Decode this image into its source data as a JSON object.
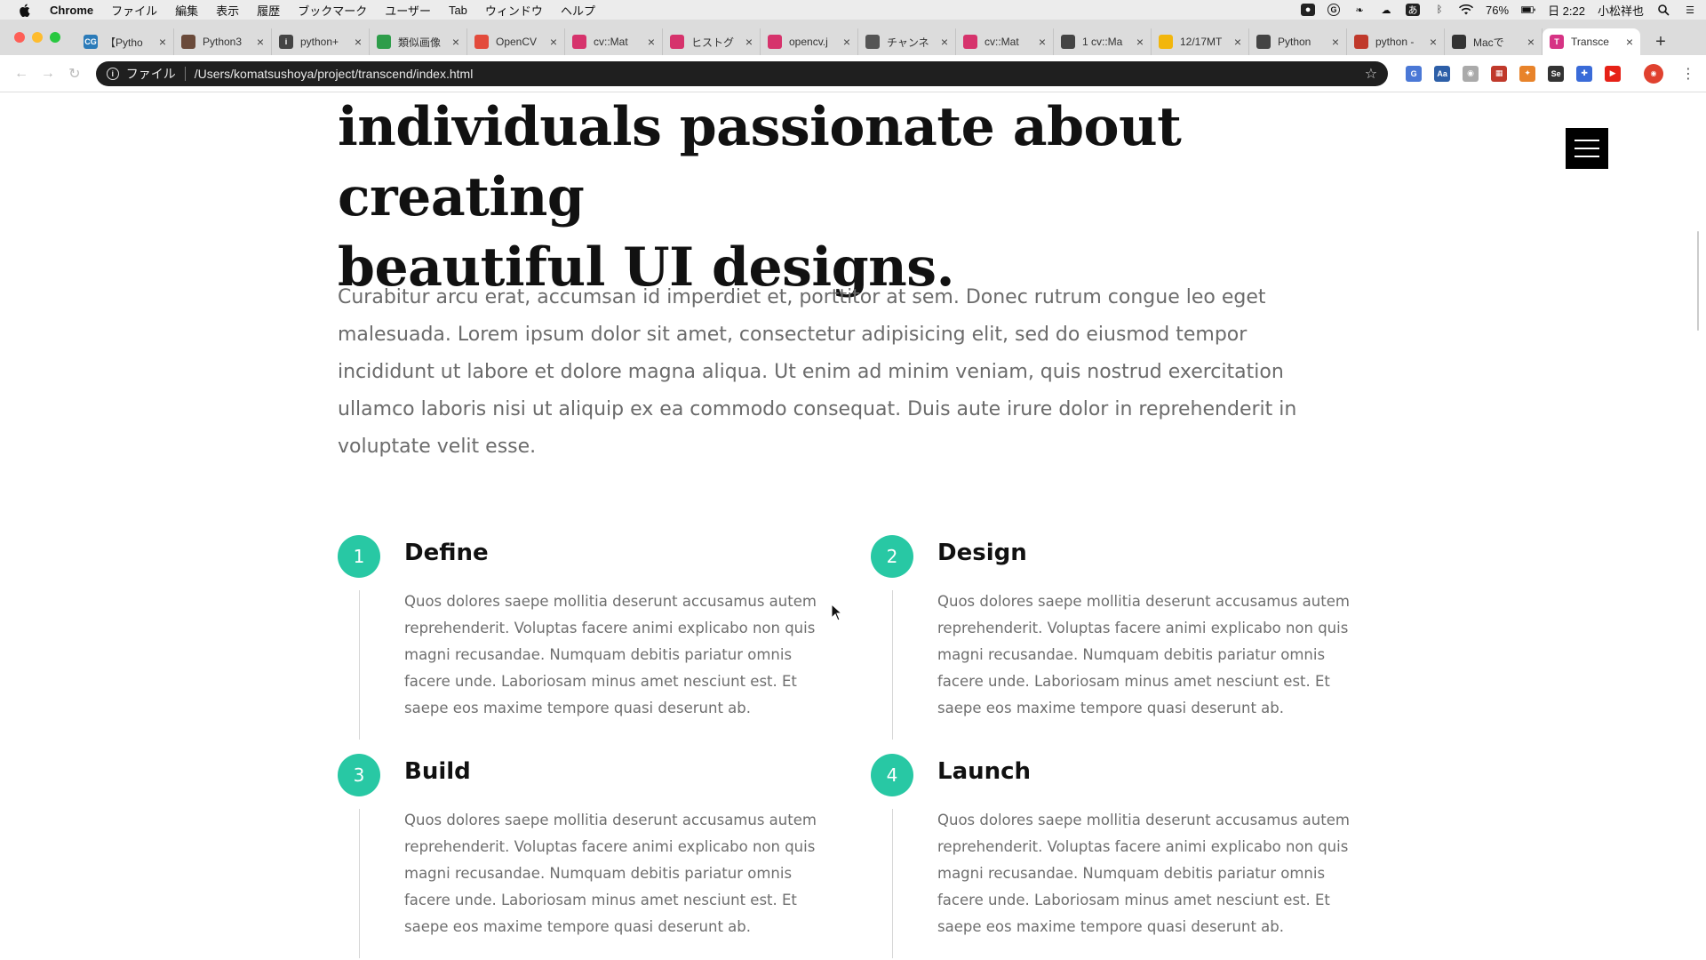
{
  "menubar": {
    "app_name": "Chrome",
    "items": [
      "ファイル",
      "編集",
      "表示",
      "履歴",
      "ブックマーク",
      "ユーザー",
      "Tab",
      "ウィンドウ",
      "ヘルプ"
    ],
    "battery": "76%",
    "clock": "日 2:22",
    "user": "小松祥也"
  },
  "tabs": [
    {
      "title": "【Pytho",
      "color": "#2b7bb9",
      "glyph": "CG"
    },
    {
      "title": "Python3",
      "color": "#6a4a3a",
      "glyph": ""
    },
    {
      "title": "python+",
      "color": "#444",
      "glyph": "i"
    },
    {
      "title": "類似画像",
      "color": "#2e9d4a",
      "glyph": ""
    },
    {
      "title": "OpenCV",
      "color": "#e34b3c",
      "glyph": ""
    },
    {
      "title": "cv::Mat",
      "color": "#d6336c",
      "glyph": ""
    },
    {
      "title": "ヒストグ",
      "color": "#d6336c",
      "glyph": ""
    },
    {
      "title": "opencv.j",
      "color": "#d6336c",
      "glyph": ""
    },
    {
      "title": "チャンネ",
      "color": "#555",
      "glyph": ""
    },
    {
      "title": "cv::Mat",
      "color": "#d6336c",
      "glyph": ""
    },
    {
      "title": "1 cv::Ma",
      "color": "#444",
      "glyph": ""
    },
    {
      "title": "12/17MT",
      "color": "#f2b60c",
      "glyph": ""
    },
    {
      "title": "Python",
      "color": "#444",
      "glyph": ""
    },
    {
      "title": "python -",
      "color": "#c0392b",
      "glyph": ""
    },
    {
      "title": "Macで",
      "color": "#333",
      "glyph": ""
    },
    {
      "title": "Transce",
      "color": "#d63384",
      "glyph": "T"
    }
  ],
  "toolbar": {
    "scheme": "ファイル",
    "url": "/Users/komatsushoya/project/transcend/index.html"
  },
  "page": {
    "headline_line1": "individuals passionate about creating",
    "headline_line2": "beautiful UI designs.",
    "lead": "Curabitur arcu erat, accumsan id imperdiet et, porttitor at sem. Donec rutrum congue leo eget malesuada. Lorem ipsum dolor sit amet, consectetur adipisicing elit, sed do eiusmod tempor incididunt ut labore et dolore magna aliqua. Ut enim ad minim veniam, quis nostrud exercitation ullamco laboris nisi ut aliquip ex ea commodo consequat. Duis aute irure dolor in reprehenderit in voluptate velit esse.",
    "accent_color": "#28c8a4",
    "steps": [
      {
        "num": "1",
        "title": "Define",
        "body": "Quos dolores saepe mollitia deserunt accusamus autem reprehenderit. Voluptas facere animi explicabo non quis magni recusandae. Numquam debitis pariatur omnis facere unde. Laboriosam minus amet nesciunt est. Et saepe eos maxime tempore quasi deserunt ab."
      },
      {
        "num": "2",
        "title": "Design",
        "body": "Quos dolores saepe mollitia deserunt accusamus autem reprehenderit. Voluptas facere animi explicabo non quis magni recusandae. Numquam debitis pariatur omnis facere unde. Laboriosam minus amet nesciunt est. Et saepe eos maxime tempore quasi deserunt ab."
      },
      {
        "num": "3",
        "title": "Build",
        "body": "Quos dolores saepe mollitia deserunt accusamus autem reprehenderit. Voluptas facere animi explicabo non quis magni recusandae. Numquam debitis pariatur omnis facere unde. Laboriosam minus amet nesciunt est. Et saepe eos maxime tempore quasi deserunt ab."
      },
      {
        "num": "4",
        "title": "Launch",
        "body": "Quos dolores saepe mollitia deserunt accusamus autem reprehenderit. Voluptas facere animi explicabo non quis magni recusandae. Numquam debitis pariatur omnis facere unde. Laboriosam minus amet nesciunt est. Et saepe eos maxime tempore quasi deserunt ab."
      }
    ]
  }
}
